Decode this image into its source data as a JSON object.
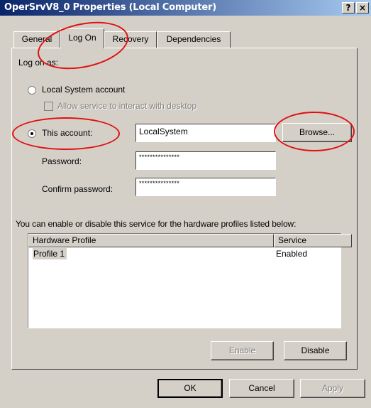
{
  "window": {
    "title": "OperSrvV8_0 Properties (Local Computer)",
    "help_button": "?",
    "close_button": "×"
  },
  "tabs": [
    {
      "label": "General",
      "active": false
    },
    {
      "label": "Log On",
      "active": true
    },
    {
      "label": "Recovery",
      "active": false
    },
    {
      "label": "Dependencies",
      "active": false
    }
  ],
  "logon": {
    "heading": "Log on as:",
    "local_system_label": "Local System account",
    "allow_interact_label": "Allow service to interact with desktop",
    "this_account_label": "This account:",
    "account_value": "LocalSystem",
    "browse_label": "Browse...",
    "password_label": "Password:",
    "password_value": "***************",
    "confirm_label": "Confirm password:",
    "confirm_value": "***************",
    "selected_option": "This account"
  },
  "hardware": {
    "description": "You can enable or disable this service for the hardware profiles listed below:",
    "columns": [
      "Hardware Profile",
      "Service"
    ],
    "rows": [
      {
        "profile": "Profile 1",
        "service": "Enabled"
      }
    ],
    "enable_label": "Enable",
    "disable_label": "Disable"
  },
  "dialog_buttons": {
    "ok": "OK",
    "cancel": "Cancel",
    "apply": "Apply"
  },
  "annotation_color": "#e01010"
}
